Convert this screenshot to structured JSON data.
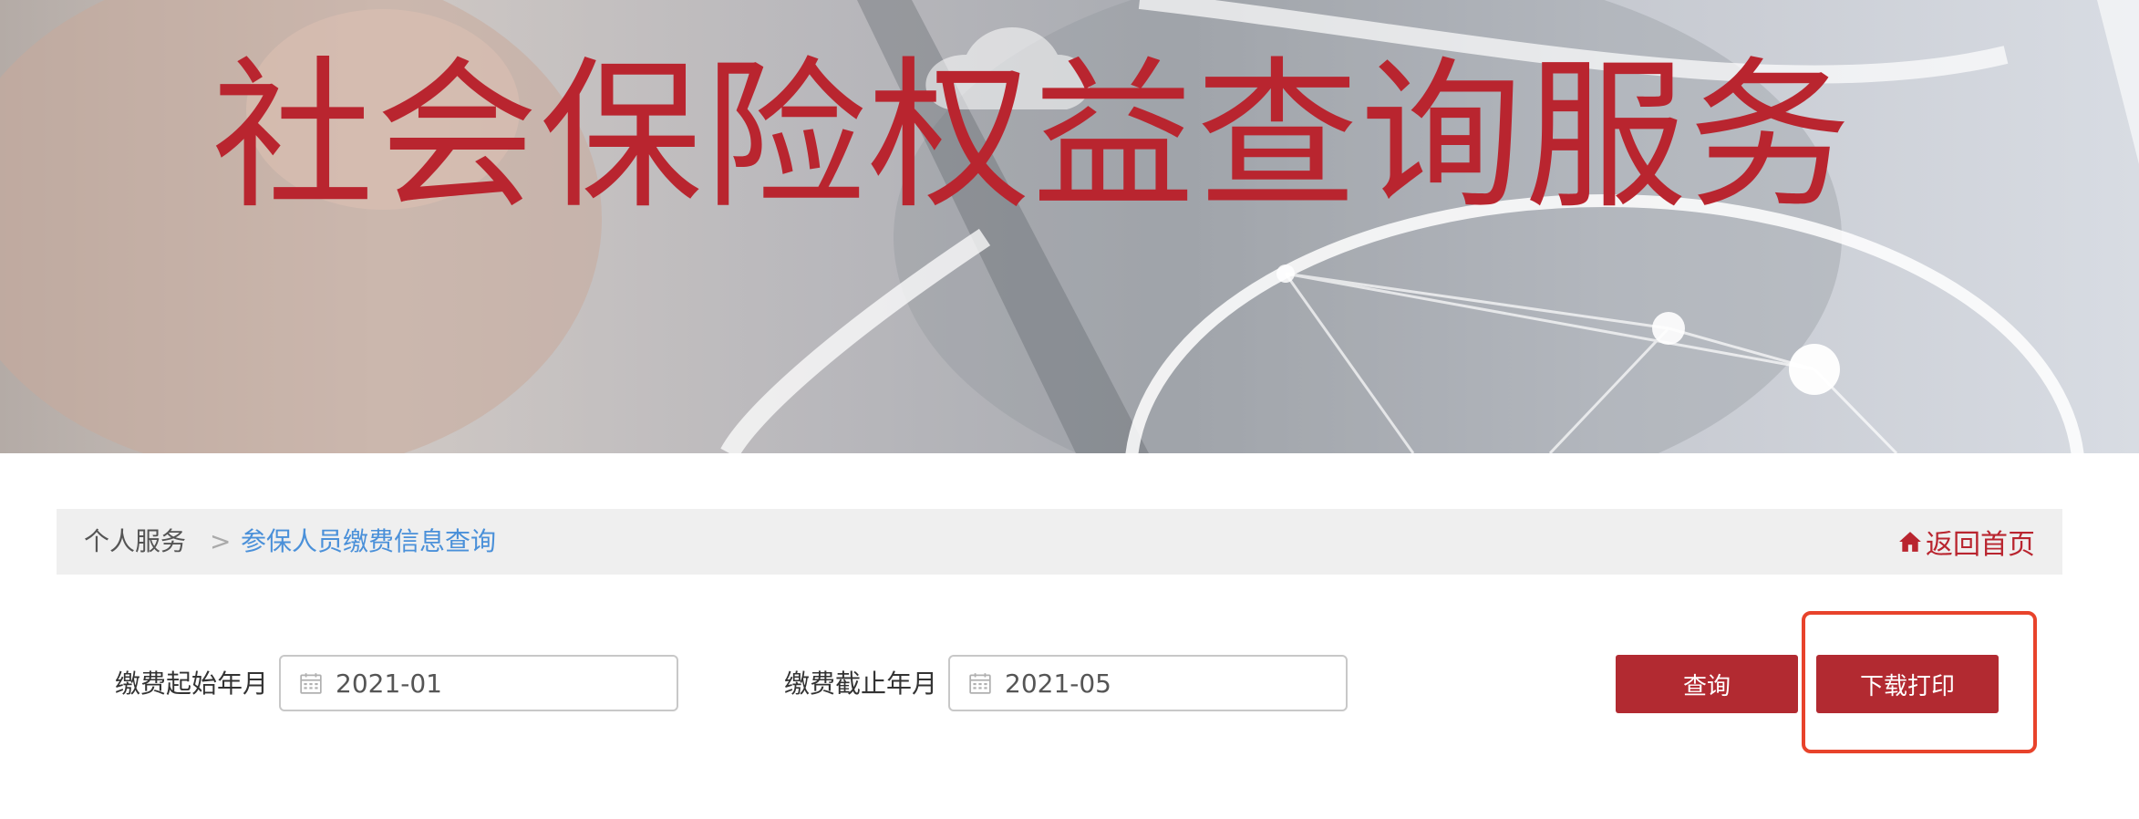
{
  "banner": {
    "title": "社会保险权益查询服务"
  },
  "breadcrumb": {
    "home": "个人服务",
    "separator": ">",
    "current": "参保人员缴费信息查询",
    "back_home_label": "返回首页"
  },
  "form": {
    "start": {
      "label": "缴费起始年月",
      "value": "2021-01"
    },
    "end": {
      "label": "缴费截止年月",
      "value": "2021-05"
    }
  },
  "buttons": {
    "query": "查询",
    "download_print": "下载打印"
  },
  "colors": {
    "brand_red": "#b22a31",
    "title_red": "#b9252f",
    "link_blue": "#4a90d9",
    "highlight_border": "#e8432b"
  }
}
